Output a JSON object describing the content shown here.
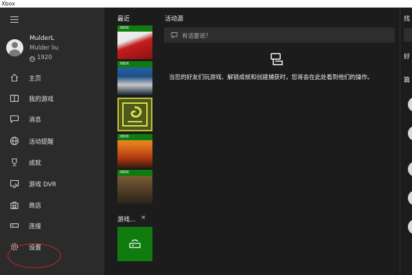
{
  "window": {
    "title": "Xbox"
  },
  "sidebar": {
    "menu_icon": "hamburger-menu-icon",
    "profile": {
      "gamertag": "MulderL",
      "real_name": "Mulder liu",
      "gamerscore": "1920"
    },
    "items": [
      {
        "label": "主页",
        "icon": "home-icon"
      },
      {
        "label": "我的游戏",
        "icon": "my-games-icon"
      },
      {
        "label": "消息",
        "icon": "messages-icon"
      },
      {
        "label": "活动提醒",
        "icon": "globe-icon"
      },
      {
        "label": "成就",
        "icon": "trophy-icon"
      },
      {
        "label": "游戏 DVR",
        "icon": "dvr-icon"
      },
      {
        "label": "商店",
        "icon": "store-icon"
      },
      {
        "label": "连接",
        "icon": "connect-icon"
      },
      {
        "label": "设置",
        "icon": "gear-icon"
      }
    ],
    "highlight_color": "#d4242a"
  },
  "recent": {
    "title": "最近",
    "tiles": [
      {
        "badge": "XBOX",
        "colors": [
          "#c41e1e",
          "#f7f7f7"
        ]
      },
      {
        "badge": "XBOX",
        "colors": [
          "#2a6fb5",
          "#1d2b3a"
        ]
      },
      {
        "badge": "",
        "colors": [
          "#4c5b1a",
          "#c9c23a"
        ]
      },
      {
        "badge": "XBOX",
        "colors": [
          "#f2a51f",
          "#b13b12"
        ]
      },
      {
        "badge": "XBOX",
        "colors": [
          "#8a6a3a",
          "#2b241c"
        ]
      }
    ],
    "pinned": {
      "title": "游戏...",
      "close": "×"
    }
  },
  "feed": {
    "title": "活动源",
    "post_placeholder": "有话要说？",
    "empty_message": "当您的好友们玩游戏、解锁成就和创建捕获时，您将会在此处看到他们的操作。"
  },
  "right_column": {
    "title_fragment": "找",
    "label_fragment_1": "好",
    "label_fragment_2": "篇"
  },
  "colors": {
    "xbox_green": "#107c10",
    "sidebar_bg": "#2b2b2b",
    "content_bg": "#1c1c1c"
  }
}
